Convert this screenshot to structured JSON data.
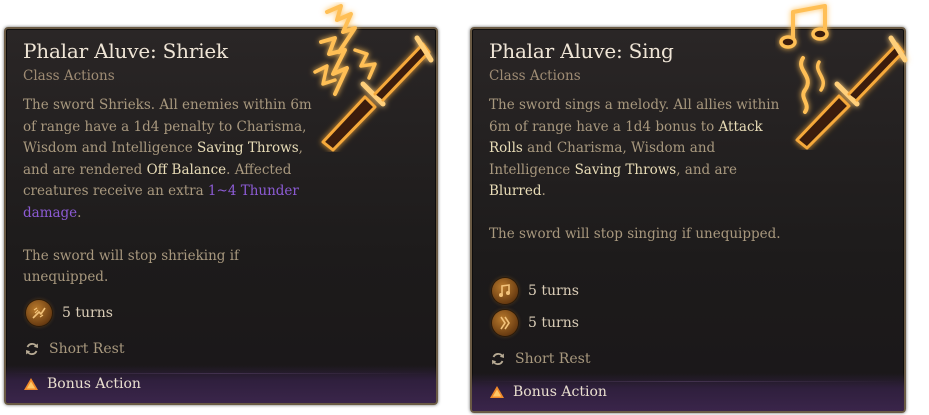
{
  "cards": [
    {
      "title": "Phalar Aluve: Shriek",
      "subtitle": "Class Actions",
      "desc": {
        "p1_a": "The sword Shrieks. All enemies within 6m of range have a 1d4 penalty to Charisma, Wisdom and Intelligence ",
        "p1_saving": "Saving Throws",
        "p1_b": ", and are rendered ",
        "p1_offbalance": "Off Balance",
        "p1_c": ". Affected creatures receive an extra ",
        "p1_damage": "1~4 Thunder damage",
        "p1_d": ".",
        "p2": "The sword will stop shrieking if unequipped."
      },
      "stat": "5 turns",
      "rest": "Short Rest",
      "action": "Bonus Action",
      "icon": "shriek-sword-icon"
    },
    {
      "title": "Phalar Aluve: Sing",
      "subtitle": "Class Actions",
      "desc": {
        "p1_a": "The sword sings a melody. All allies within 6m of range have a 1d4 bonus to ",
        "p1_attack": "Attack Rolls",
        "p1_b": " and Charisma, Wisdom and Intelligence ",
        "p1_saving": "Saving Throws",
        "p1_c": ", and are ",
        "p1_blurred": "Blurred",
        "p1_d": ".",
        "p2": "The sword will stop singing if unequipped."
      },
      "stat1": "5 turns",
      "stat2": "5 turns",
      "rest": "Short Rest",
      "action": "Bonus Action",
      "icon": "sing-sword-icon"
    }
  ],
  "colors": {
    "accent_gold": "#f6a93a",
    "keyword": "#e8dcb7",
    "damage_purple": "#8c5bd4",
    "body_text": "#a8987e",
    "action_bar": "#3a254a"
  }
}
